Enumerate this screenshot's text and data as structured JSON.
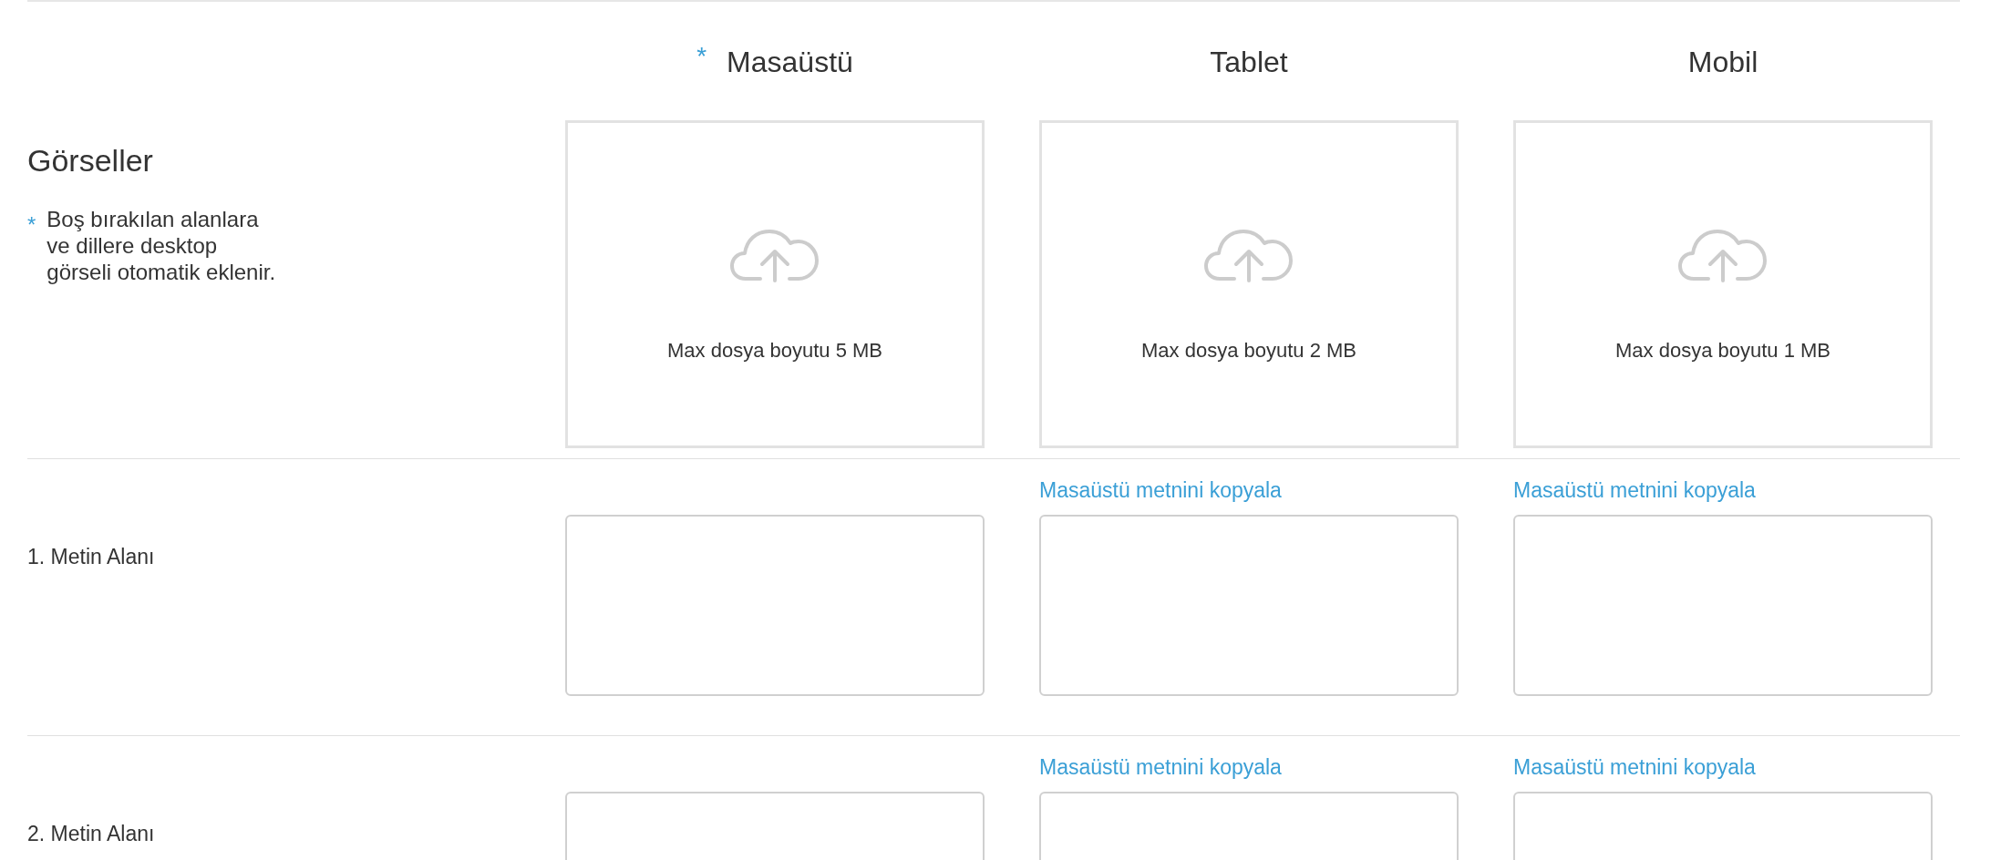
{
  "images_section": {
    "title": "Görseller",
    "note_mark": "*",
    "note_lines": [
      "Boş bırakılan alanlara",
      "ve dillere desktop",
      "görseli otomatik eklenir."
    ],
    "columns": [
      {
        "label": "Masaüstü",
        "required_mark": "*",
        "upload_hint": "Max dosya boyutu 5 MB"
      },
      {
        "label": "Tablet",
        "upload_hint": "Max dosya boyutu 2 MB"
      },
      {
        "label": "Mobil",
        "upload_hint": "Max dosya boyutu 1 MB"
      }
    ]
  },
  "text_fields": [
    {
      "label": "1. Metin Alanı",
      "inputs": [
        {
          "kind": "text_area"
        },
        {
          "kind": "text_area",
          "copy_link": "Masaüstü metnini kopyala"
        },
        {
          "kind": "text_area",
          "copy_link": "Masaüstü metnini kopyala"
        }
      ]
    },
    {
      "label": "2. Metin Alanı",
      "inputs": [
        {
          "kind": "text_area"
        },
        {
          "kind": "text_area",
          "copy_link": "Masaüstü metnini kopyala"
        },
        {
          "kind": "text_area",
          "copy_link": "Masaüstü metnini kopyala"
        }
      ]
    }
  ]
}
